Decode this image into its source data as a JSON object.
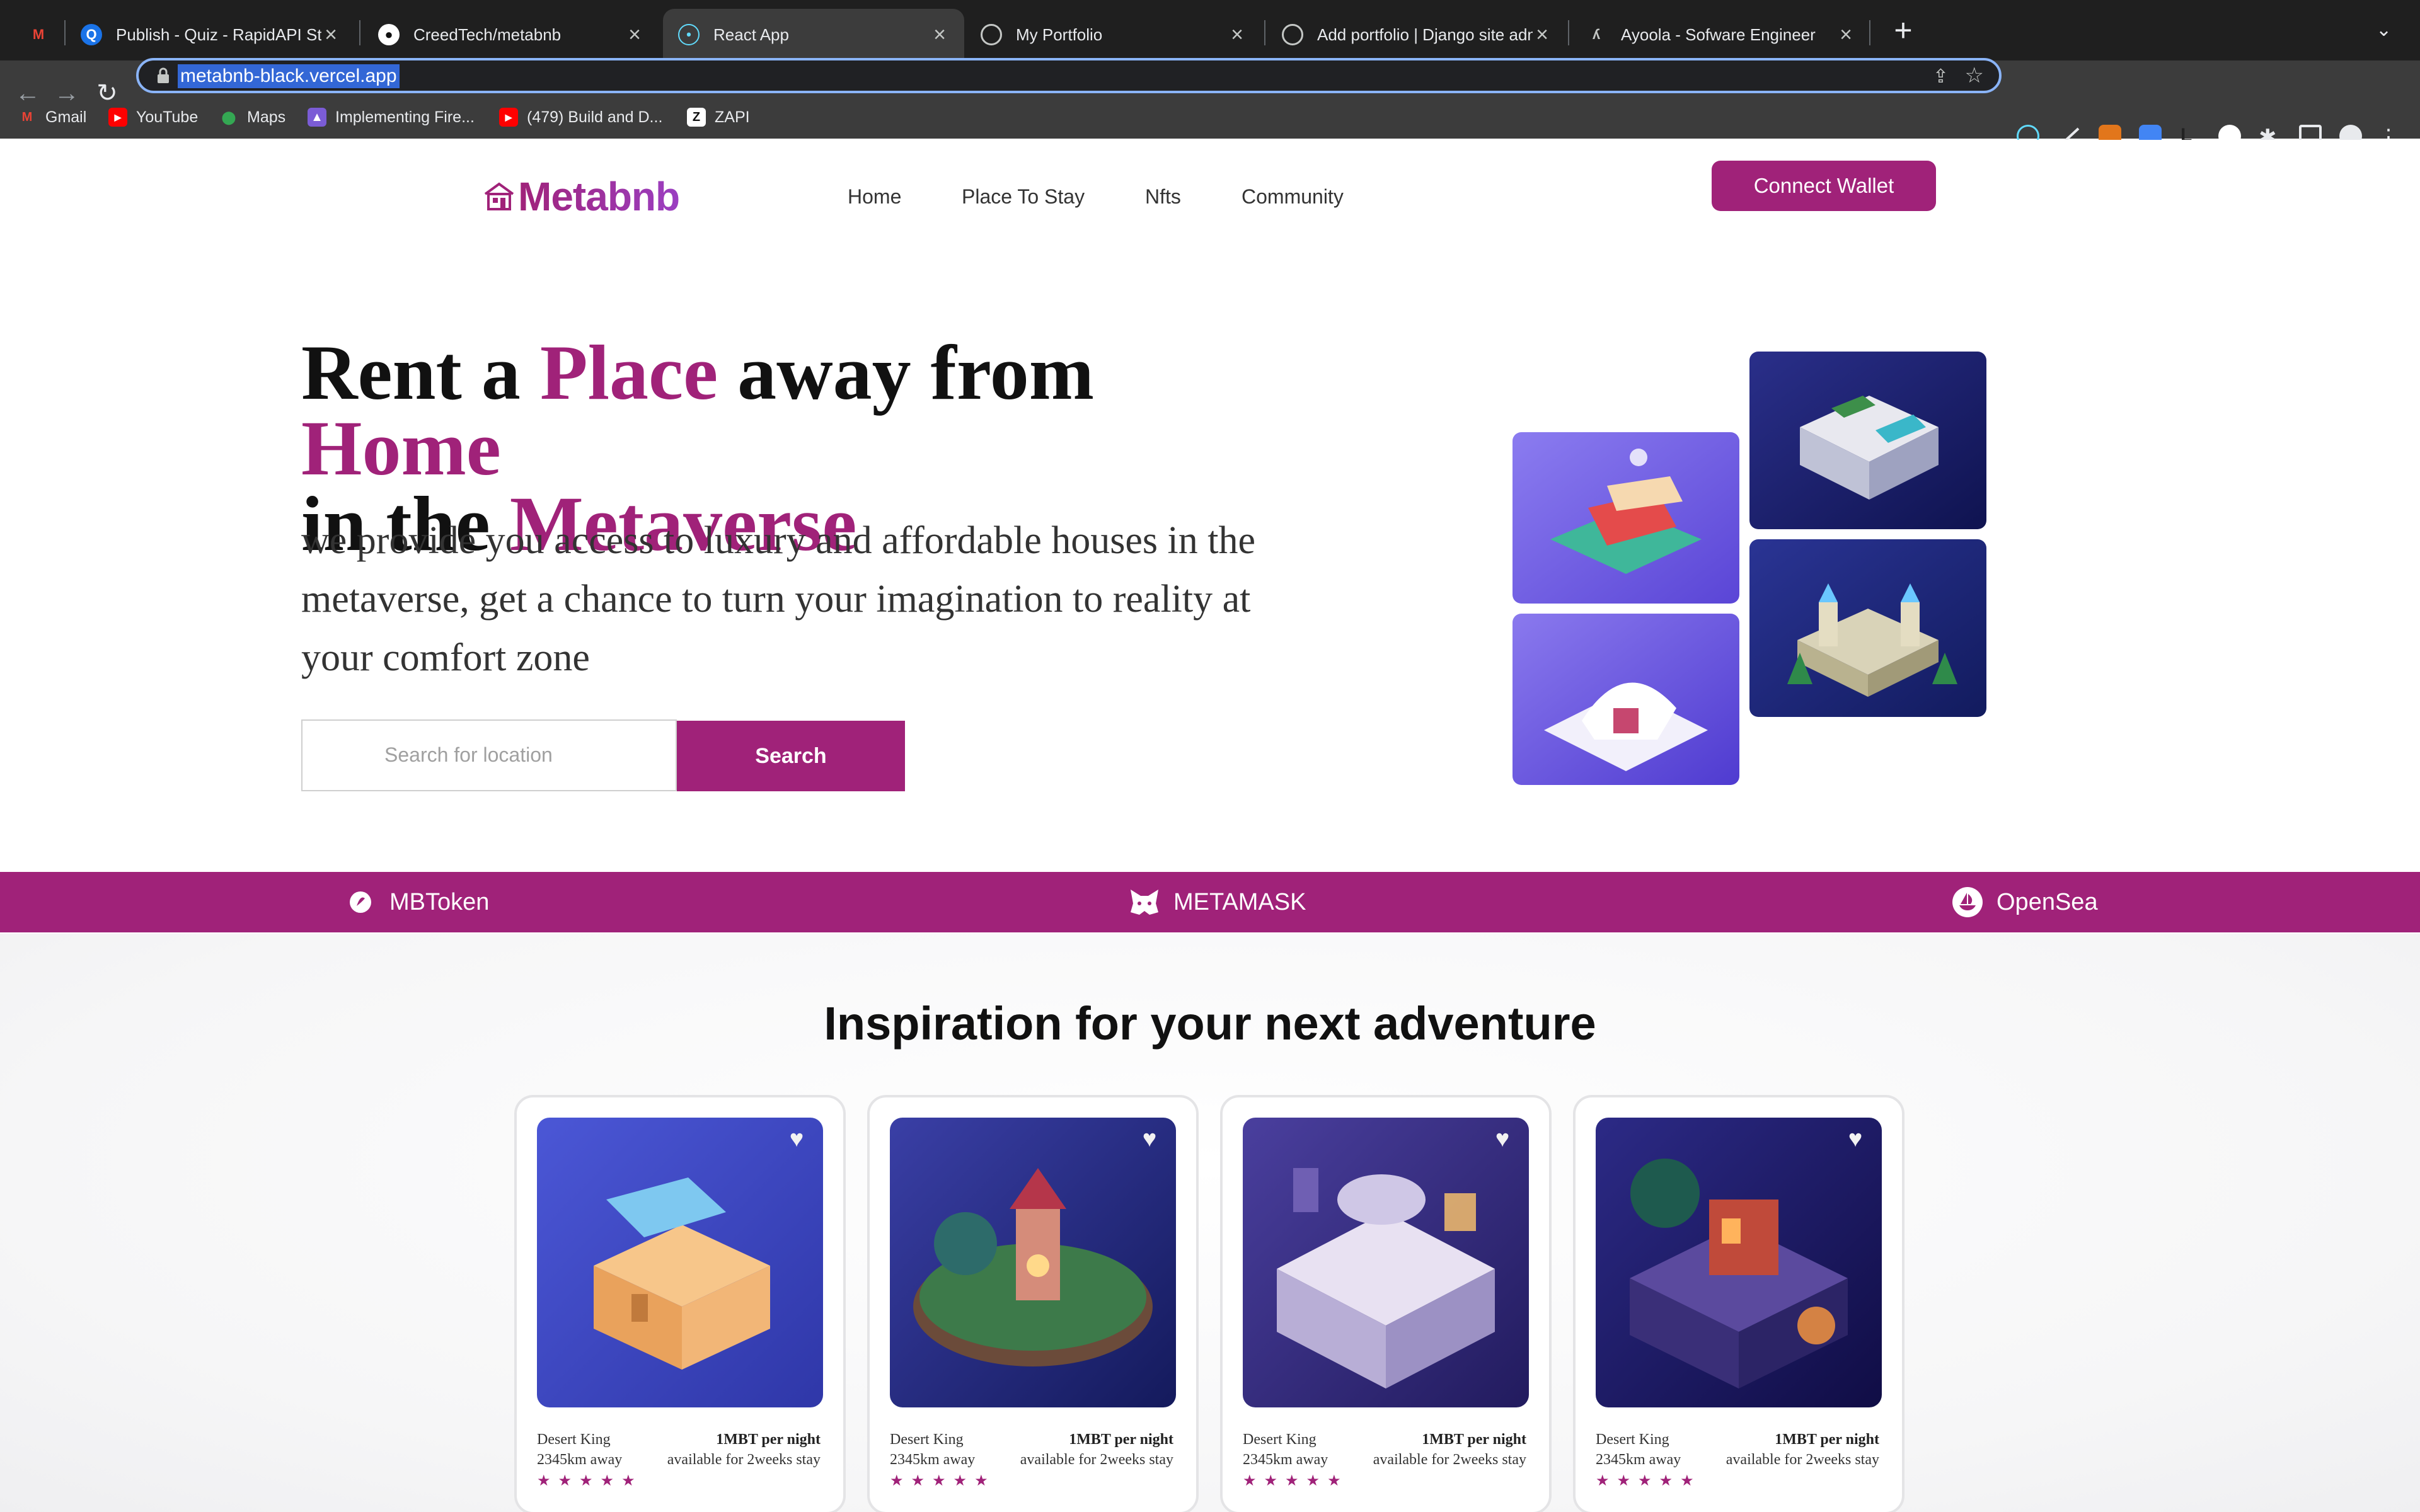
{
  "browser": {
    "tabs": [
      {
        "title": "",
        "icon": "gmail-icon"
      },
      {
        "title": "Publish - Quiz - RapidAPI Stud",
        "icon": "rapidapi-icon"
      },
      {
        "title": "CreedTech/metabnb",
        "icon": "github-icon"
      },
      {
        "title": "React App",
        "icon": "react-icon",
        "active": true
      },
      {
        "title": "My Portfolio",
        "icon": "globe-icon"
      },
      {
        "title": "Add portfolio | Django site adm",
        "icon": "globe-icon"
      },
      {
        "title": "Ayoola - Sofware Engineer",
        "icon": "ayoola-icon"
      }
    ],
    "url": "metabnb-black.vercel.app",
    "bookmarks": [
      {
        "label": "Gmail",
        "icon": "gmail-icon"
      },
      {
        "label": "YouTube",
        "icon": "youtube-icon"
      },
      {
        "label": "Maps",
        "icon": "maps-icon"
      },
      {
        "label": "Implementing Fire...",
        "icon": "bookmark-icon"
      },
      {
        "label": "(479) Build and D...",
        "icon": "youtube-icon"
      },
      {
        "label": "ZAPI",
        "icon": "zapi-icon"
      }
    ]
  },
  "site": {
    "brand": "Metabnb",
    "nav": [
      "Home",
      "Place To Stay",
      "Nfts",
      "Community"
    ],
    "connect_label": "Connect Wallet",
    "accent_color": "#a02279"
  },
  "hero": {
    "title_parts": [
      "Rent a ",
      "Place",
      " away from ",
      "Home",
      "in the ",
      "Metaverse"
    ],
    "subtitle": "we provide you access to luxury and affordable houses in the metaverse, get a chance to turn your imagination to reality at your comfort zone",
    "search_placeholder": "Search for location",
    "search_label": "Search"
  },
  "partners": [
    {
      "label": "MBToken",
      "icon": "mbtoken-icon"
    },
    {
      "label": "METAMASK",
      "icon": "metamask-fox-icon"
    },
    {
      "label": "OpenSea",
      "icon": "opensea-icon"
    }
  ],
  "section": {
    "title": "Inspiration for your next adventure"
  },
  "cards": [
    {
      "name": "Desert King",
      "distance": "2345km away",
      "price": "1MBT per night",
      "availability": "available for 2weeks stay",
      "stars": "★★★★★"
    },
    {
      "name": "Desert King",
      "distance": "2345km away",
      "price": "1MBT per night",
      "availability": "available for 2weeks stay",
      "stars": "★★★★★"
    },
    {
      "name": "Desert King",
      "distance": "2345km away",
      "price": "1MBT per night",
      "availability": "available for 2weeks stay",
      "stars": "★★★★★"
    },
    {
      "name": "Desert King",
      "distance": "2345km away",
      "price": "1MBT per night",
      "availability": "available for 2weeks stay",
      "stars": "★★★★★"
    }
  ]
}
